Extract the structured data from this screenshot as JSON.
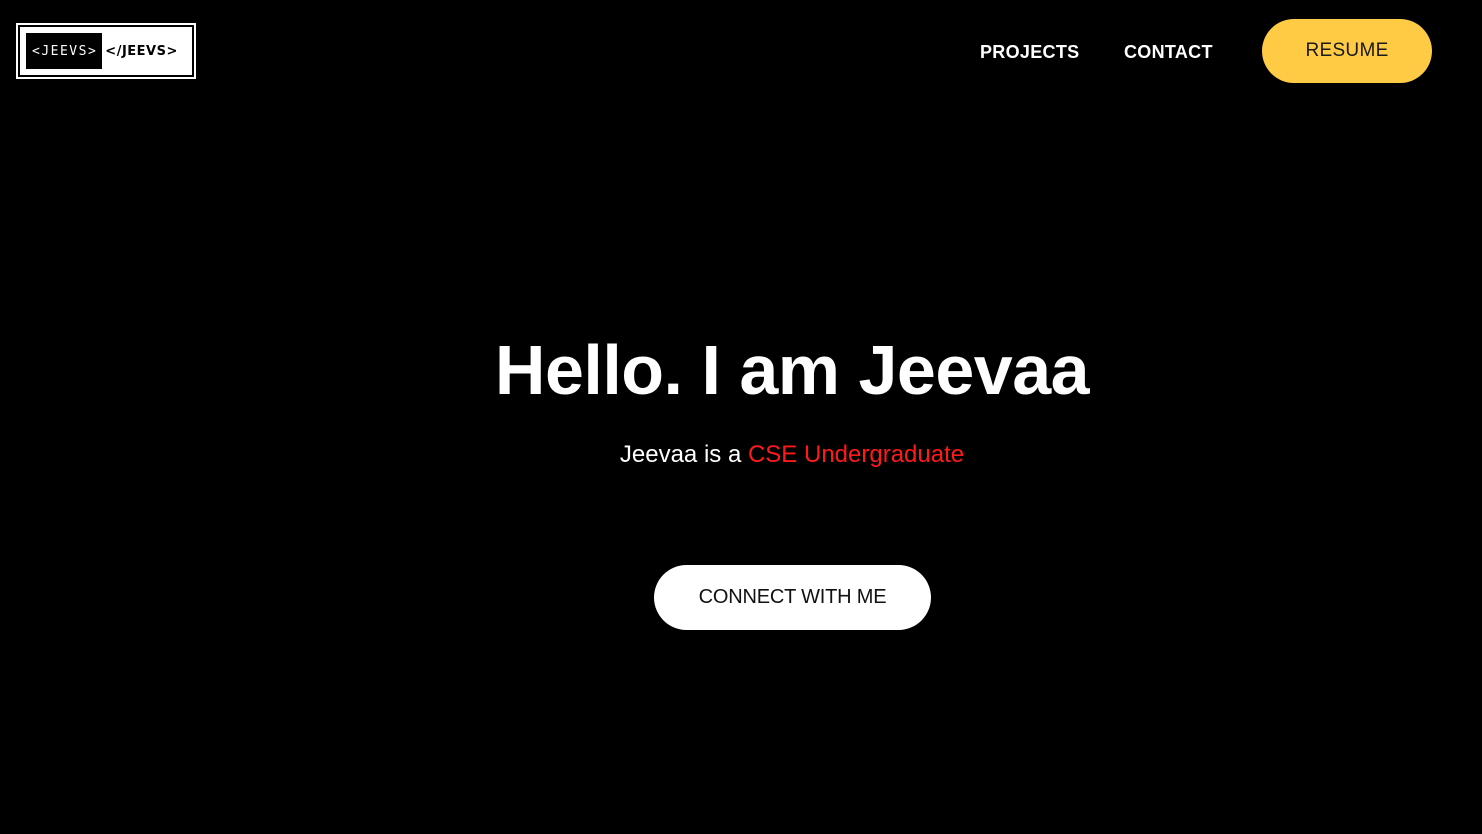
{
  "logo": {
    "left_text": "<JEEVS>",
    "right_text": "</JEEVS>"
  },
  "nav": {
    "projects_label": "PROJECTS",
    "contact_label": "CONTACT",
    "resume_label": "RESUME"
  },
  "hero": {
    "title": "Hello. I am Jeevaa",
    "subtitle_prefix": "Jeevaa is a ",
    "subtitle_highlight": "CSE Undergraduate",
    "cta_label": "CONNECT WITH ME"
  },
  "colors": {
    "background": "#000000",
    "accent_yellow": "#ffcb45",
    "accent_red": "#ff1a1a",
    "text_primary": "#ffffff"
  }
}
